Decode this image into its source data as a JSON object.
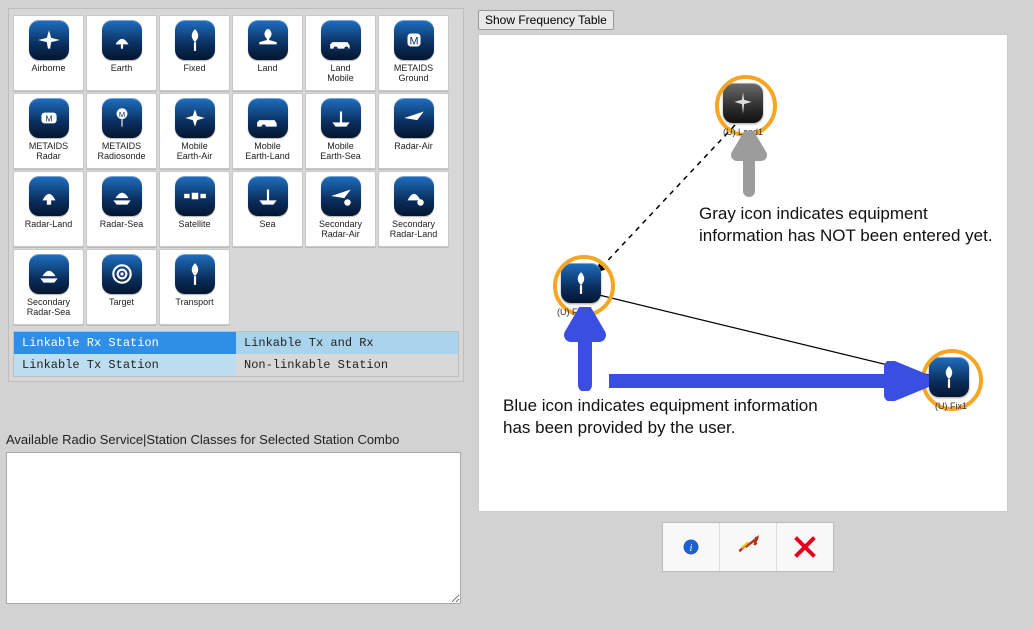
{
  "palette": {
    "items": [
      {
        "label": "Airborne",
        "icon": "airborne-icon"
      },
      {
        "label": "Earth",
        "icon": "earth-icon"
      },
      {
        "label": "Fixed",
        "icon": "fixed-icon"
      },
      {
        "label": "Land",
        "icon": "land-icon"
      },
      {
        "label": "Land\nMobile",
        "icon": "land-mobile-icon"
      },
      {
        "label": "METAIDS\nGround",
        "icon": "metaids-ground-icon"
      },
      {
        "label": "METAIDS\nRadar",
        "icon": "metaids-radar-icon"
      },
      {
        "label": "METAIDS\nRadiosonde",
        "icon": "metaids-radiosonde-icon"
      },
      {
        "label": "Mobile\nEarth-Air",
        "icon": "mobile-earth-air-icon"
      },
      {
        "label": "Mobile\nEarth-Land",
        "icon": "mobile-earth-land-icon"
      },
      {
        "label": "Mobile\nEarth-Sea",
        "icon": "mobile-earth-sea-icon"
      },
      {
        "label": "Radar-Air",
        "icon": "radar-air-icon"
      },
      {
        "label": "Radar-Land",
        "icon": "radar-land-icon"
      },
      {
        "label": "Radar-Sea",
        "icon": "radar-sea-icon"
      },
      {
        "label": "Satellite",
        "icon": "satellite-icon"
      },
      {
        "label": "Sea",
        "icon": "sea-icon"
      },
      {
        "label": "Secondary\nRadar-Air",
        "icon": "secondary-radar-air-icon"
      },
      {
        "label": "Secondary\nRadar-Land",
        "icon": "secondary-radar-land-icon"
      },
      {
        "label": "Secondary\nRadar-Sea",
        "icon": "secondary-radar-sea-icon"
      },
      {
        "label": "Target",
        "icon": "target-icon"
      },
      {
        "label": "Transport",
        "icon": "transport-icon"
      }
    ]
  },
  "legend": {
    "rx": "Linkable Rx Station",
    "txrx": "Linkable Tx and Rx",
    "tx": "Linkable Tx Station",
    "nonlink": "Non-linkable Station",
    "colors": {
      "rx": "#2f8fe6",
      "txrx": "#aad4ec",
      "tx": "#bcdef0",
      "nonlink": "#d8d8d8"
    }
  },
  "section": {
    "available_label": "Available Radio Service|Station Classes for Selected Station Combo"
  },
  "buttons": {
    "show_freq": "Show Frequency Table"
  },
  "canvas": {
    "nodes": {
      "land1": {
        "label": "(U) Land1",
        "icon": "land-icon",
        "state": "gray"
      },
      "fix_left": {
        "label": "(U) Fix",
        "icon": "fixed-icon",
        "state": "blue"
      },
      "fix1": {
        "label": "(U) Fix1",
        "icon": "fixed-icon",
        "state": "blue"
      }
    },
    "annotations": {
      "gray_note": "Gray icon indicates equipment information has NOT been entered yet.",
      "blue_note": "Blue icon indicates equipment information has been provided by the user."
    }
  },
  "toolbar": {
    "info": "info-icon",
    "lightning": "link-icon",
    "delete": "delete-icon"
  }
}
